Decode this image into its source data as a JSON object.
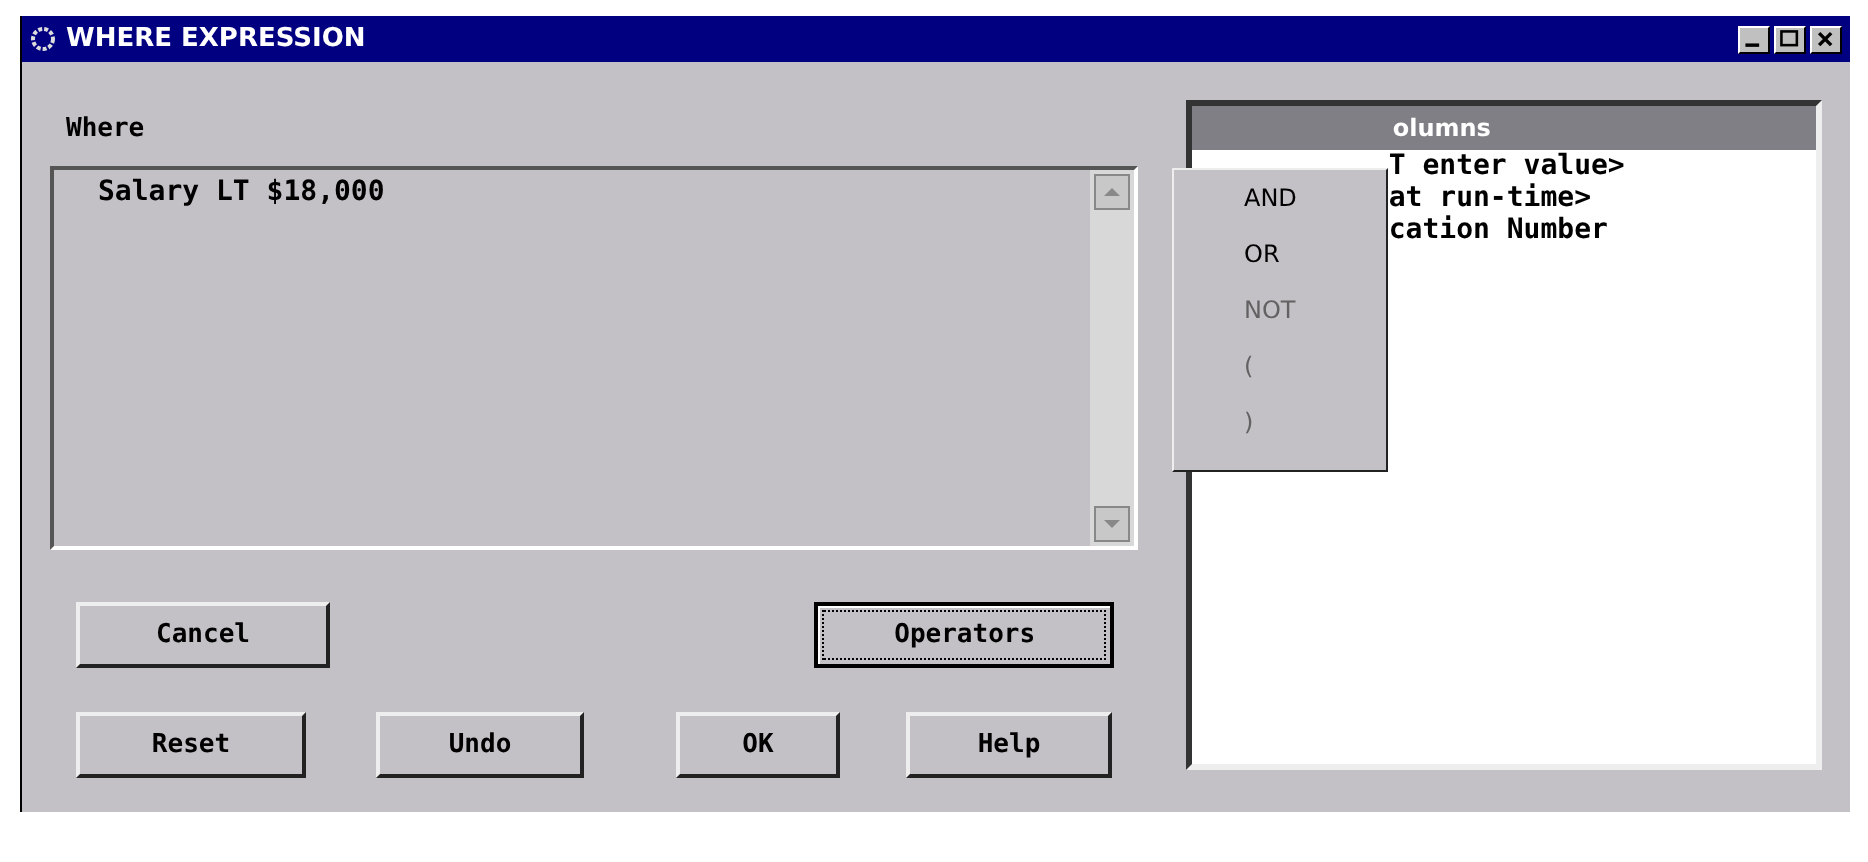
{
  "window": {
    "title": "WHERE EXPRESSION"
  },
  "where": {
    "label": "Where",
    "value": "Salary LT $18,000"
  },
  "columns_list": {
    "header": "olumns",
    "items": [
      "T enter value>",
      "at run-time>",
      "cation Number"
    ]
  },
  "operators_menu": [
    {
      "label": "AND",
      "disabled": false
    },
    {
      "label": "OR",
      "disabled": false
    },
    {
      "label": "NOT",
      "disabled": true
    },
    {
      "label": "(",
      "disabled": true
    },
    {
      "label": ")",
      "disabled": true
    }
  ],
  "buttons": [
    {
      "label": "Cancel",
      "focused": false
    },
    {
      "label": "Operators",
      "focused": true
    },
    {
      "label": "Reset",
      "focused": false
    },
    {
      "label": "Undo",
      "focused": false
    },
    {
      "label": "OK",
      "focused": false
    },
    {
      "label": "Help",
      "focused": false
    }
  ]
}
